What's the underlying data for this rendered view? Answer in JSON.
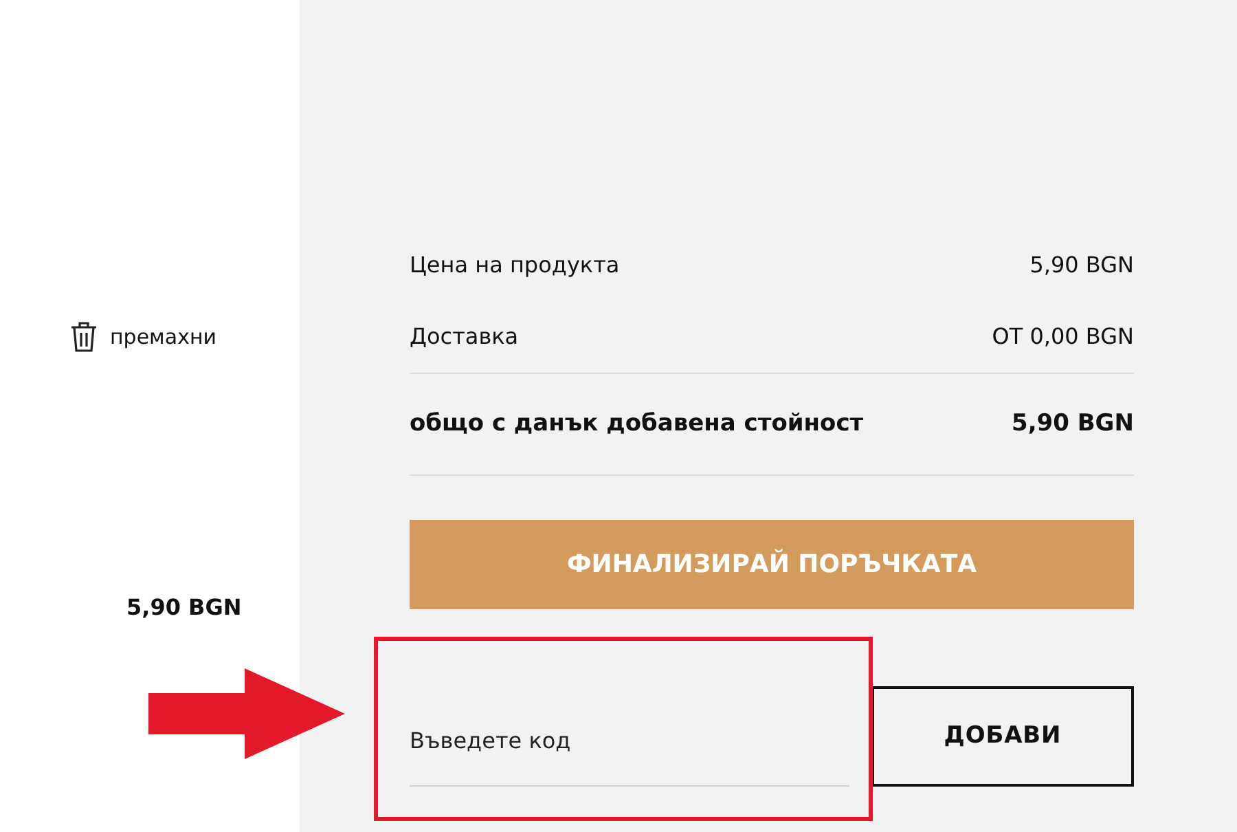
{
  "cart_item": {
    "remove_label": "премахни",
    "price": "5,90 BGN"
  },
  "summary": {
    "rows": [
      {
        "label": "Цена на продукта",
        "value": "5,90 BGN",
        "kind": "line"
      },
      {
        "label": "Доставка",
        "value": "ОТ 0,00 BGN",
        "kind": "line"
      },
      {
        "label": "общо с данък добавена стойност",
        "value": "5,90 BGN",
        "kind": "total"
      }
    ],
    "checkout_button": "ФИНАЛИЗИРАЙ ПОРЪЧКАТА"
  },
  "coupon": {
    "placeholder": "Въведете код",
    "button": "ДОБАВИ"
  }
}
